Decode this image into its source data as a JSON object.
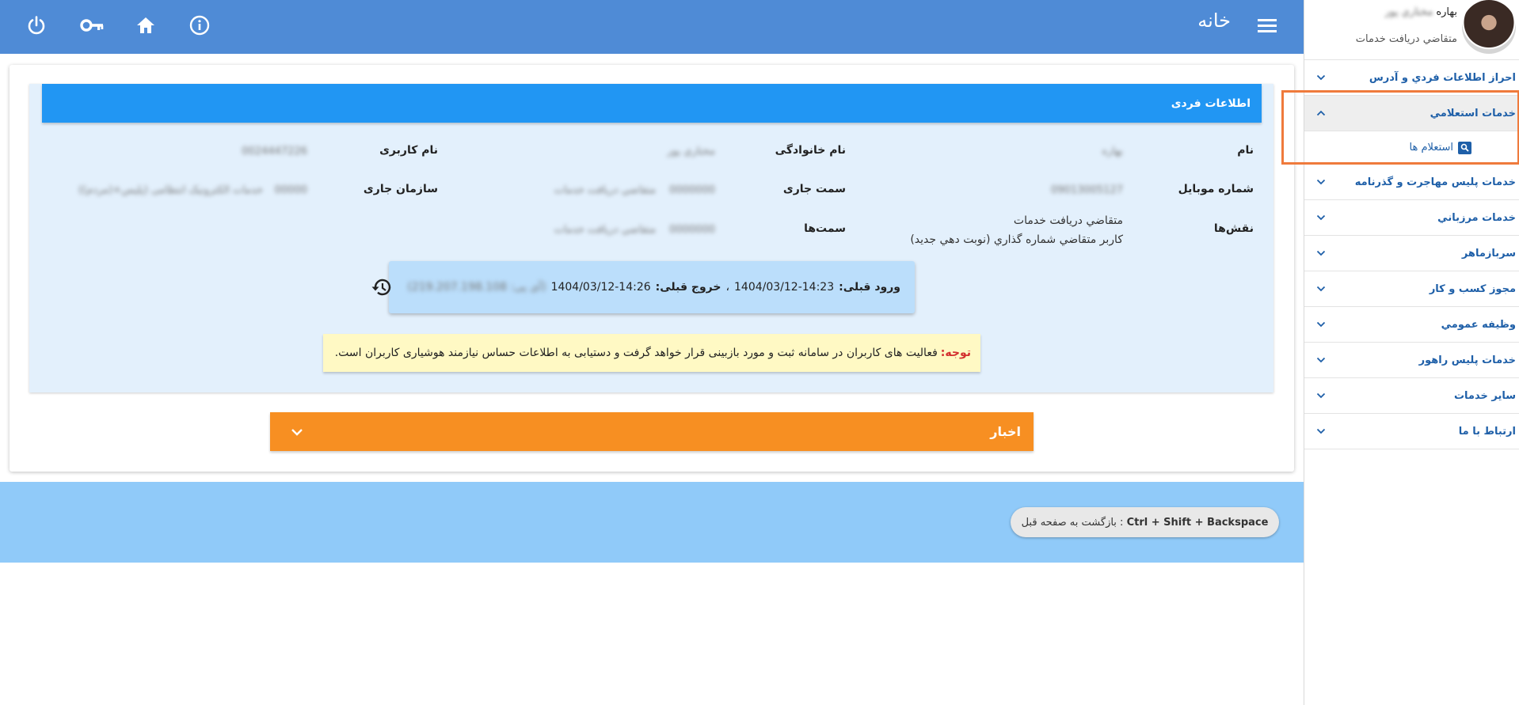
{
  "topbar": {
    "title": "خانه",
    "icons": [
      "menu-icon",
      "info-icon",
      "home-icon",
      "key-icon",
      "power-icon"
    ]
  },
  "sidebar": {
    "user_name": "بهاره",
    "user_family_blurred": "مختاري پور",
    "user_role": "متقاضي دريافت خدمات",
    "items": [
      {
        "label": "احراز اطلاعات فردي و آدرس",
        "expanded": false
      },
      {
        "label": "خدمات استعلامي",
        "expanded": true
      },
      {
        "label": "خدمات پليس مهاجرت و گذرنامه",
        "expanded": false
      },
      {
        "label": "خدمات مرزباني",
        "expanded": false
      },
      {
        "label": "سربازماهر",
        "expanded": false
      },
      {
        "label": "مجوز كسب و كار",
        "expanded": false
      },
      {
        "label": "وظيفه عمومي",
        "expanded": false
      },
      {
        "label": "خدمات پليس راهور",
        "expanded": false
      },
      {
        "label": "ساير خدمات",
        "expanded": false
      },
      {
        "label": "ارتباط با ما",
        "expanded": false
      }
    ],
    "subitem_label": "استعلام ها"
  },
  "info": {
    "header": "اطلاعات فردی",
    "labels": {
      "name": "نام",
      "family": "نام خانوادگی",
      "username": "نام کاربری",
      "mobile": "شماره موبایل",
      "position": "سمت جاری",
      "org": "سازمان جاری",
      "roles": "نقش‌ها",
      "positions": "سمت‌ها"
    },
    "values": {
      "name": "بهاره",
      "family": "مختاري پور",
      "username": "0024447226",
      "mobile": "09013005127",
      "position_code": "0000000",
      "position_name": "متقاضي دريافت خدمات",
      "org_code": "00000",
      "org_name": "خدمات الکترونیک انتظامی (پلیس+(مردم))",
      "positions_code": "0000000",
      "positions_name": "متقاضي دريافت خدمات"
    },
    "roles": [
      "متقاضي دريافت خدمات",
      "كاربر متقاضي شماره گذاري (نوبت دهي جديد)"
    ]
  },
  "login": {
    "last_login_label": "ورود قبلی:",
    "last_login_value": "1404/03/12-14:23",
    "separator": "،",
    "last_logout_label": "خروج قبلی:",
    "last_logout_value": "1404/03/12-14:26",
    "ip_blurred": "(آی پی: 219.207.198.108)",
    "icon": "history-icon"
  },
  "notice": {
    "label": "توجه:",
    "text": "فعالیت های کاربران در سامانه ثبت و مورد بازبینی قرار خواهد گرفت و دستیابی به اطلاعات حساس نیازمند هوشیاری کاربران است."
  },
  "news": {
    "label": "اخبار"
  },
  "footer": {
    "shortcut": "Ctrl + Shift + Backspace",
    "shortcut_text": ": بازگشت به صفحه قبل"
  },
  "colors": {
    "topbar": "#4f8bd6",
    "info_header": "#2196f3",
    "info_bg": "#e3f0fc",
    "news": "#f78f22",
    "footer": "#90caf9",
    "sidebar_link": "#1e5fa8",
    "highlight": "#ef7a3c"
  }
}
